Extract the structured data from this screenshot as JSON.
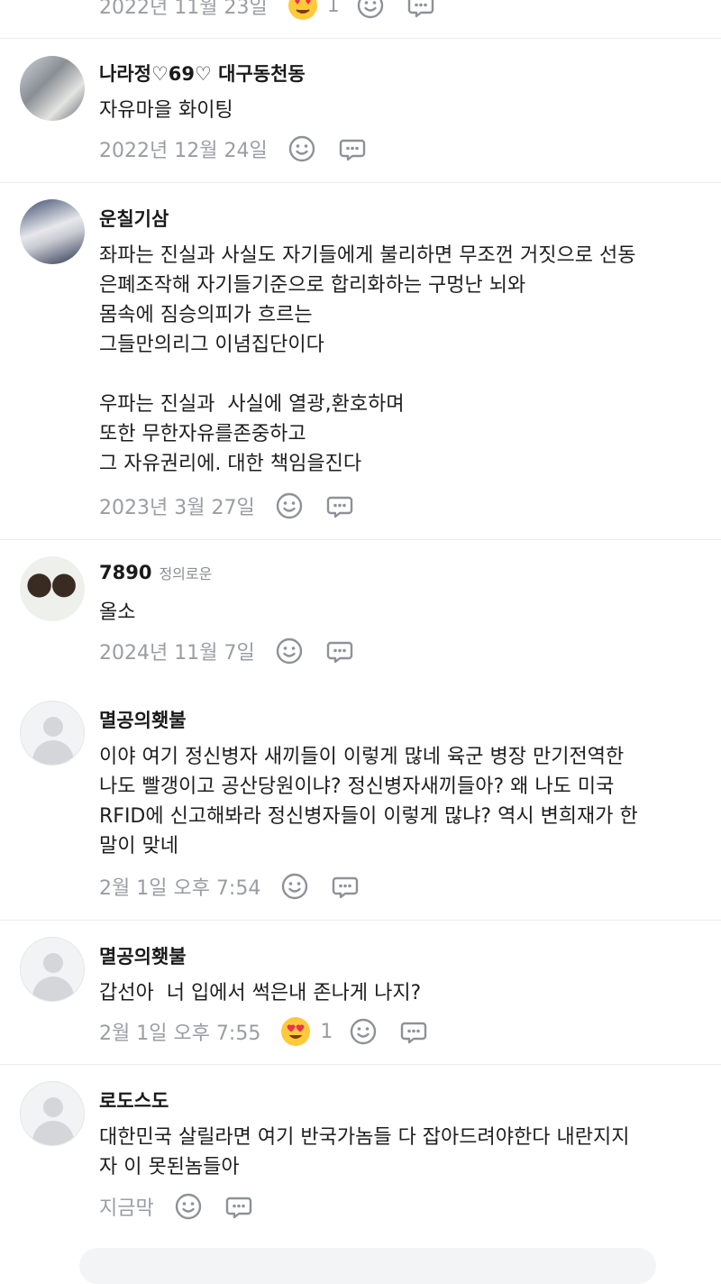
{
  "top_stub": {
    "date": "2022년 11월 23일",
    "reaction_count": "1"
  },
  "comments": [
    {
      "name": "나라정♡69♡ 대구동천동",
      "badge": "",
      "body": "자유마을 화이팅",
      "date": "2022년 12월 24일",
      "reaction_count": ""
    },
    {
      "name": "운칠기삼",
      "badge": "",
      "body": "좌파는 진실과 사실도 자기들에게 불리하면 무조껀 거짓으로 선동\n은폐조작해 자기들기준으로 합리화하는 구멍난 뇌와\n몸속에 짐승의피가 흐르는\n그들만의리그 이념집단이다\n\n우파는 진실과  사실에 열광,환호하며\n또한 무한자유를존중하고\n그 자유권리에. 대한 책임을진다",
      "date": "2023년 3월 27일",
      "reaction_count": ""
    },
    {
      "name": "7890",
      "badge": "정의로운",
      "body": "올소",
      "date": "2024년 11월 7일",
      "reaction_count": ""
    },
    {
      "name": "멸공의횃불",
      "badge": "",
      "body": "이야 여기 정신병자 새끼들이 이렇게 많네 육군 병장 만기전역한\n나도 빨갱이고 공산당원이냐? 정신병자새끼들아? 왜 나도 미국\nRFID에 신고해봐라 정신병자들이 이렇게 많냐? 역시 변희재가 한\n말이 맞네",
      "date": "2월 1일 오후 7:54",
      "reaction_count": ""
    },
    {
      "name": "멸공의횃불",
      "badge": "",
      "body": "갑선아  너 입에서 썩은내 존나게 나지?",
      "date": "2월 1일 오후 7:55",
      "reaction_count": "1"
    },
    {
      "name": "로도스도",
      "badge": "",
      "body": "대한민국 살릴라면 여기 반국가놈들 다 잡아드려야한다 내란지지\n자 이 못된놈들아",
      "date": "지금막",
      "reaction_count": ""
    }
  ],
  "icons": {
    "emotion": "smiley-icon",
    "reply": "chat-bubble-icon",
    "reaction": "heart-eyes-emoji-icon"
  },
  "colors": {
    "meta_text": "#9a9da3",
    "divider": "#ececec",
    "icon_stroke": "#8e9197"
  }
}
